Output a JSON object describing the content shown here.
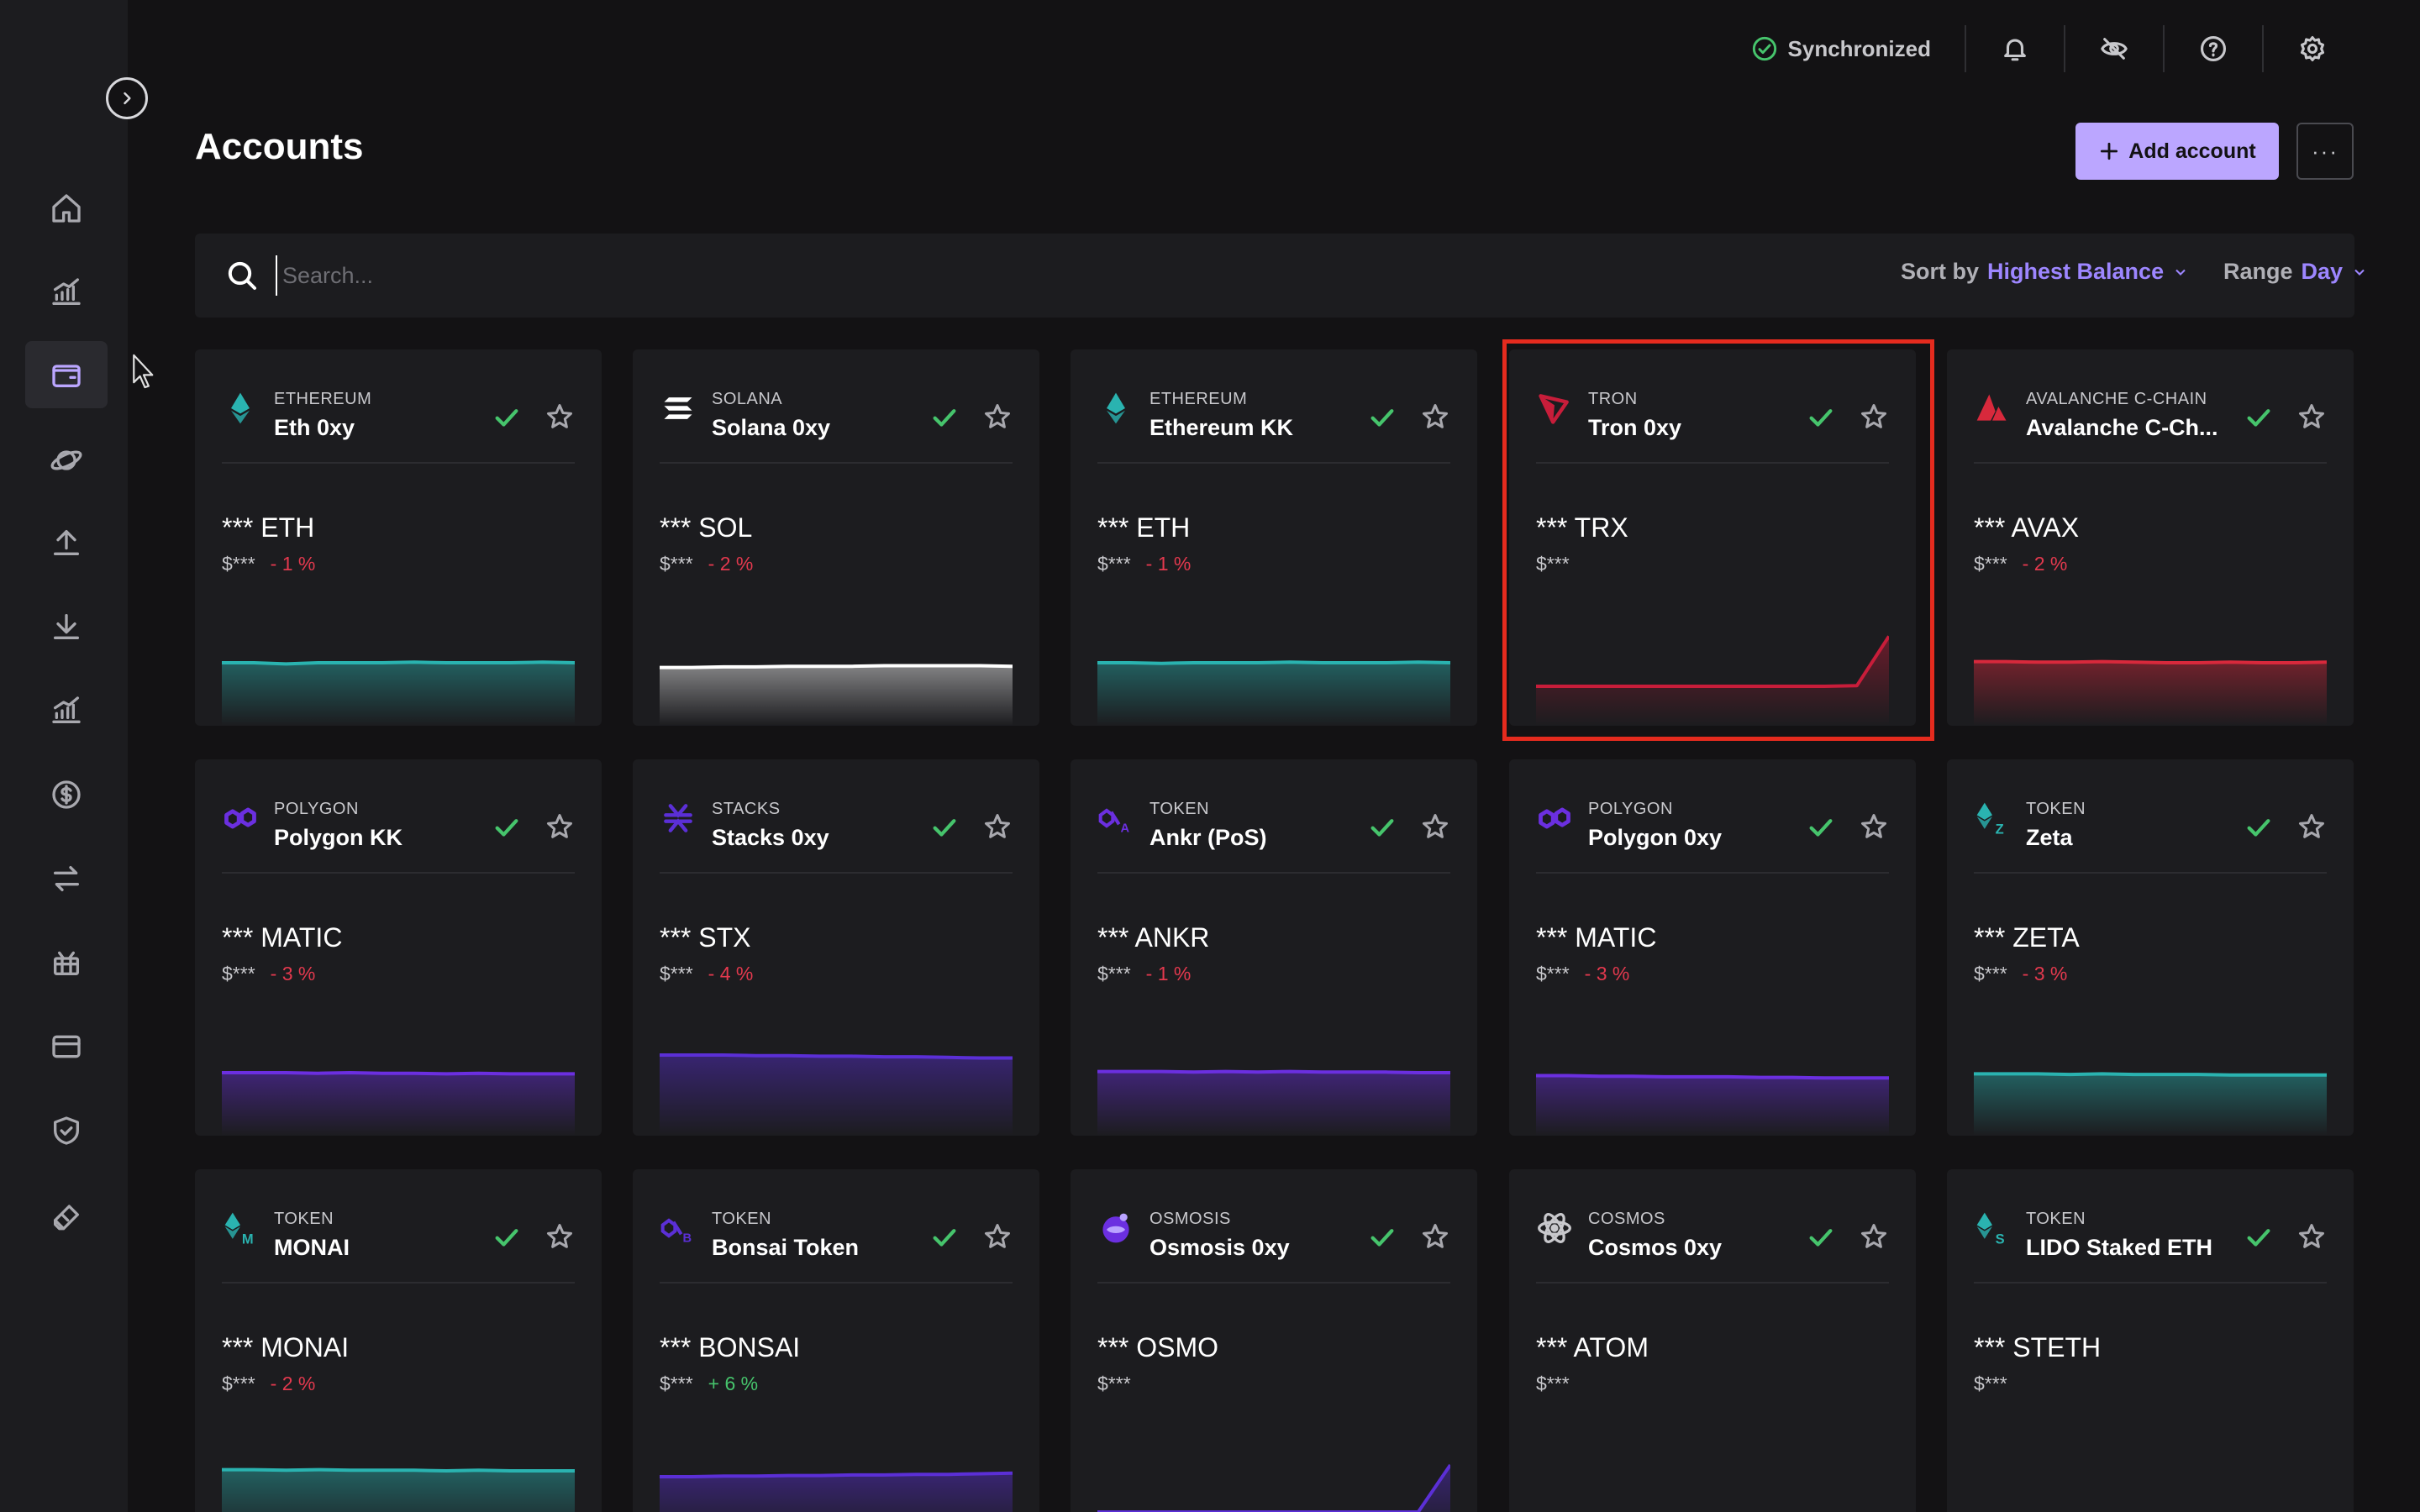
{
  "app": {
    "page_title": "Accounts",
    "sync_status": "Synchronized",
    "add_account_label": "Add account",
    "more_label": "···"
  },
  "search": {
    "placeholder": "Search...",
    "value": ""
  },
  "sort": {
    "label": "Sort by",
    "value": "Highest Balance"
  },
  "range": {
    "label": "Range",
    "value": "Day"
  },
  "sidebar": {
    "items": [
      {
        "icon": "home-icon",
        "active": false
      },
      {
        "icon": "market-chart-icon",
        "active": false
      },
      {
        "icon": "wallet-icon",
        "active": true
      },
      {
        "icon": "discover-planet-icon",
        "active": false
      },
      {
        "icon": "send-icon",
        "active": false
      },
      {
        "icon": "receive-icon",
        "active": false
      },
      {
        "icon": "earn-chart-icon",
        "active": false
      },
      {
        "icon": "dollar-icon",
        "active": false
      },
      {
        "icon": "swap-icon",
        "active": false
      },
      {
        "icon": "gift-icon",
        "active": false
      },
      {
        "icon": "card-icon",
        "active": false
      },
      {
        "icon": "shield-icon",
        "active": false
      },
      {
        "icon": "ledger-device-icon",
        "active": false
      }
    ]
  },
  "colors": {
    "accent": "#bba6ff",
    "accent_text": "#9d86ff",
    "positive": "#46c46c",
    "negative": "#e3394e",
    "eth": "#2ab3b0",
    "sol": "#ffffff",
    "trx": "#c81d3a",
    "avax": "#d8293c",
    "polygon": "#6b2fe0",
    "highlight": "#e52b1e"
  },
  "accounts": [
    {
      "network": "ETHEREUM",
      "name": "Eth 0xy",
      "balance": "*** ETH",
      "fiat": "$***",
      "change": "- 1 %",
      "change_sign": "neg",
      "icon": "ethereum-icon",
      "color": "#2ab3b0",
      "trend": [
        0.5,
        0.5,
        0.48,
        0.5,
        0.5,
        0.5,
        0.51,
        0.5,
        0.5,
        0.5,
        0.51,
        0.5
      ]
    },
    {
      "network": "SOLANA",
      "name": "Solana 0xy",
      "balance": "*** SOL",
      "fiat": "$***",
      "change": "- 2 %",
      "change_sign": "neg",
      "icon": "solana-icon",
      "color": "#ffffff",
      "trend": [
        0.42,
        0.42,
        0.43,
        0.43,
        0.44,
        0.44,
        0.44,
        0.45,
        0.45,
        0.45,
        0.45,
        0.44
      ]
    },
    {
      "network": "ETHEREUM",
      "name": "Ethereum KK",
      "balance": "*** ETH",
      "fiat": "$***",
      "change": "- 1 %",
      "change_sign": "neg",
      "icon": "ethereum-icon",
      "color": "#2ab3b0",
      "trend": [
        0.5,
        0.5,
        0.49,
        0.5,
        0.5,
        0.5,
        0.51,
        0.5,
        0.5,
        0.5,
        0.51,
        0.5
      ]
    },
    {
      "network": "TRON",
      "name": "Tron 0xy",
      "balance": "*** TRX",
      "fiat": "$***",
      "change": "",
      "change_sign": "neutral",
      "icon": "tron-icon",
      "color": "#c81d3a",
      "trend": [
        0.1,
        0.1,
        0.1,
        0.1,
        0.1,
        0.1,
        0.1,
        0.1,
        0.1,
        0.1,
        0.11,
        0.95
      ]
    },
    {
      "network": "AVALANCHE C-CHAIN",
      "name": "Avalanche C-Ch...",
      "balance": "*** AVAX",
      "fiat": "$***",
      "change": "- 2 %",
      "change_sign": "neg",
      "icon": "avalanche-icon",
      "color": "#d8293c",
      "trend": [
        0.52,
        0.52,
        0.51,
        0.51,
        0.52,
        0.51,
        0.5,
        0.5,
        0.51,
        0.5,
        0.5,
        0.51
      ]
    },
    {
      "network": "POLYGON",
      "name": "Polygon KK",
      "balance": "*** MATIC",
      "fiat": "$***",
      "change": "- 3 %",
      "change_sign": "neg",
      "icon": "polygon-icon",
      "color": "#6b2fe0",
      "trend": [
        0.5,
        0.5,
        0.5,
        0.49,
        0.5,
        0.49,
        0.49,
        0.48,
        0.49,
        0.48,
        0.48,
        0.48
      ]
    },
    {
      "network": "STACKS",
      "name": "Stacks 0xy",
      "balance": "*** STX",
      "fiat": "$***",
      "change": "- 4 %",
      "change_sign": "neg",
      "icon": "stacks-icon",
      "color": "#5b2fd6",
      "trend": [
        0.8,
        0.8,
        0.8,
        0.79,
        0.79,
        0.78,
        0.78,
        0.77,
        0.77,
        0.76,
        0.75,
        0.75
      ]
    },
    {
      "network": "TOKEN",
      "name": "Ankr (PoS)",
      "balance": "*** ANKR",
      "fiat": "$***",
      "change": "- 1 %",
      "change_sign": "neg",
      "icon": "ankr-icon",
      "color": "#6b2fe0",
      "trend": [
        0.52,
        0.52,
        0.52,
        0.51,
        0.52,
        0.51,
        0.52,
        0.51,
        0.51,
        0.51,
        0.5,
        0.5
      ]
    },
    {
      "network": "POLYGON",
      "name": "Polygon 0xy",
      "balance": "*** MATIC",
      "fiat": "$***",
      "change": "- 3 %",
      "change_sign": "neg",
      "icon": "polygon-icon",
      "color": "#6b2fe0",
      "trend": [
        0.45,
        0.45,
        0.44,
        0.44,
        0.43,
        0.43,
        0.43,
        0.42,
        0.42,
        0.41,
        0.41,
        0.41
      ]
    },
    {
      "network": "TOKEN",
      "name": "Zeta",
      "balance": "*** ZETA",
      "fiat": "$***",
      "change": "- 3 %",
      "change_sign": "neg",
      "icon": "zeta-icon",
      "color": "#2ab3b0",
      "trend": [
        0.48,
        0.48,
        0.48,
        0.47,
        0.48,
        0.47,
        0.47,
        0.47,
        0.46,
        0.46,
        0.46,
        0.46
      ]
    },
    {
      "network": "TOKEN",
      "name": "MONAI",
      "balance": "*** MONAI",
      "fiat": "$***",
      "change": "- 2 %",
      "change_sign": "neg",
      "icon": "monai-icon",
      "color": "#2ab3b0",
      "trend": [
        0.72,
        0.72,
        0.71,
        0.72,
        0.71,
        0.71,
        0.71,
        0.7,
        0.71,
        0.7,
        0.7,
        0.7
      ]
    },
    {
      "network": "TOKEN",
      "name": "Bonsai Token",
      "balance": "*** BONSAI",
      "fiat": "$***",
      "change": "+ 6 %",
      "change_sign": "pos",
      "icon": "bonsai-icon",
      "color": "#5b2fd6",
      "trend": [
        0.6,
        0.6,
        0.61,
        0.61,
        0.62,
        0.62,
        0.63,
        0.63,
        0.64,
        0.64,
        0.65,
        0.66
      ]
    },
    {
      "network": "OSMOSIS",
      "name": "Osmosis 0xy",
      "balance": "*** OSMO",
      "fiat": "$***",
      "change": "",
      "change_sign": "neutral",
      "icon": "osmosis-icon",
      "color": "#5b2fd6",
      "trend": [
        0.0,
        0.0,
        0.0,
        0.0,
        0.0,
        0.0,
        0.0,
        0.0,
        0.0,
        0.0,
        0.0,
        0.8
      ]
    },
    {
      "network": "COSMOS",
      "name": "Cosmos 0xy",
      "balance": "*** ATOM",
      "fiat": "$***",
      "change": "",
      "change_sign": "neutral",
      "icon": "cosmos-icon",
      "color": "#2a2a2f",
      "trend": []
    },
    {
      "network": "TOKEN",
      "name": "LIDO Staked ETH",
      "balance": "*** STETH",
      "fiat": "$***",
      "change": "",
      "change_sign": "neutral",
      "icon": "lido-icon",
      "color": "#2a2a2f",
      "trend": []
    }
  ]
}
